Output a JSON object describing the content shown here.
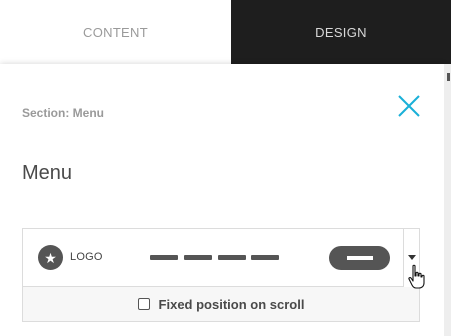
{
  "tabs": {
    "content_label": "CONTENT",
    "design_label": "DESIGN"
  },
  "panel": {
    "section_label": "Section: Menu",
    "heading": "Menu",
    "close_icon": "close-x-icon"
  },
  "preview": {
    "logo_icon": "star-icon",
    "logo_glyph": "★",
    "logo_text": "LOGO",
    "nav_item_count": 4,
    "button_icon": "menu-pill-icon"
  },
  "options": {
    "fixed_position_label": "Fixed position on scroll",
    "fixed_position_checked": false
  },
  "colors": {
    "accent": "#1ab0d8",
    "design_tab_bg": "#1e1e1e",
    "preview_dark": "#555555"
  }
}
